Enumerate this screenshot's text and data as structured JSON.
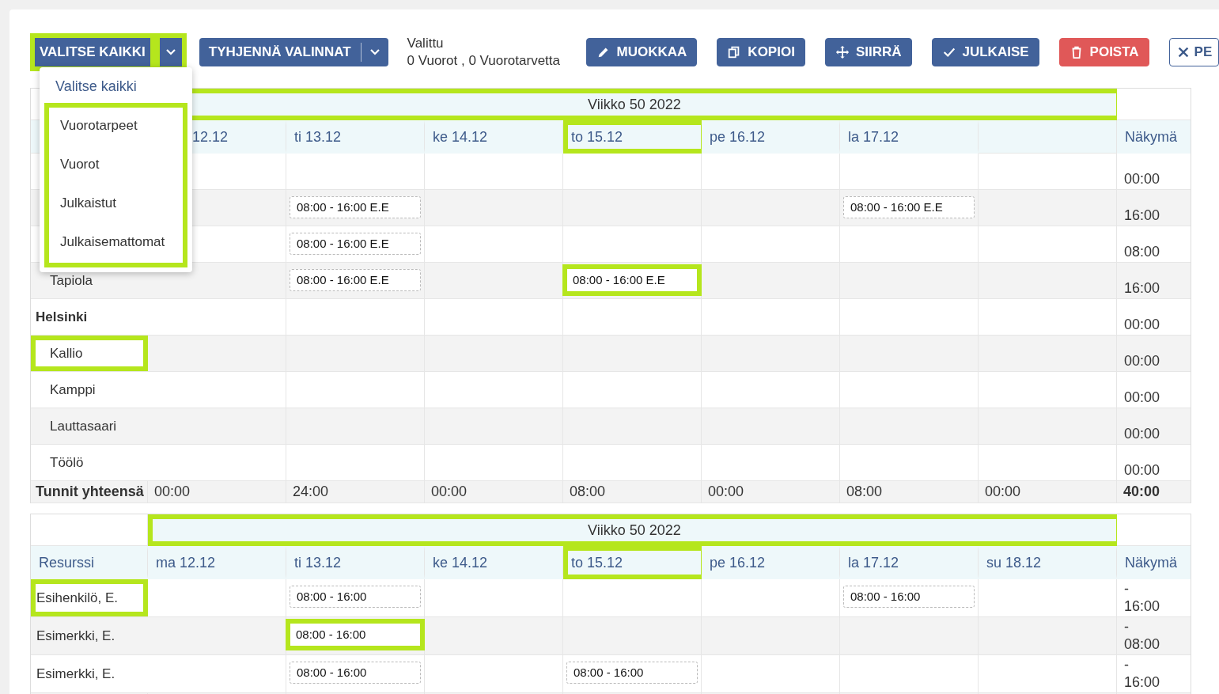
{
  "toolbar": {
    "select_all": {
      "label": "VALITSE KAIKKI",
      "highlighted": true,
      "toggle_highlighted": true
    },
    "clear": {
      "label": "TYHJENNÄ VALINNAT"
    },
    "selection_info": {
      "title": "Valittu",
      "summary": "0 Vuorot , 0 Vuorotarvetta"
    },
    "actions": [
      {
        "label": "MUOKKAA",
        "kind": "edit"
      },
      {
        "label": "KOPIOI",
        "kind": "copy"
      },
      {
        "label": "SIIRRÄ",
        "kind": "move"
      },
      {
        "label": "JULKAISE",
        "kind": "publish"
      },
      {
        "label": "POISTA",
        "kind": "delete"
      },
      {
        "label": "PE",
        "kind": "close"
      }
    ]
  },
  "select_menu": {
    "title": "Valitse kaikki",
    "options_highlighted": true,
    "options": [
      "Vuorotarpeet",
      "Vuorot",
      "Julkaistut",
      "Julkaisemattomat"
    ]
  },
  "tables": [
    {
      "week": {
        "label": "Viikko 50 2022",
        "highlighted": true
      },
      "days": [
        {
          "label": "12.12",
          "highlighted": false
        },
        {
          "label": "ti 13.12",
          "highlighted": false
        },
        {
          "label": "ke 14.12",
          "highlighted": false
        },
        {
          "label": "to 15.12",
          "highlighted": true
        },
        {
          "label": "pe 16.12",
          "highlighted": false
        },
        {
          "label": "la 17.12",
          "highlighted": false
        }
      ],
      "summary_header": "Näkymä",
      "rows": [
        {
          "kind": "hidden",
          "cells": [
            {},
            {},
            {},
            {},
            {},
            {},
            {}
          ],
          "summary": "00:00"
        },
        {
          "kind": "hidden",
          "cells": [
            {},
            {
              "shift": "08:00 - 16:00 E.E",
              "highlighted": false
            },
            {},
            {},
            {},
            {
              "shift": "08:00 - 16:00 E.E",
              "highlighted": false
            },
            {}
          ],
          "summary": "16:00"
        },
        {
          "kind": "hidden",
          "cells": [
            {},
            {
              "shift": "08:00 - 16:00 E.E",
              "highlighted": false
            },
            {},
            {},
            {},
            {},
            {}
          ],
          "summary": "08:00"
        },
        {
          "kind": "item",
          "label": "Tapiola",
          "highlighted": false,
          "cells": [
            {},
            {
              "shift": "08:00 - 16:00 E.E",
              "highlighted": false
            },
            {},
            {
              "shift": "08:00 - 16:00 E.E",
              "highlighted": true
            },
            {},
            {},
            {}
          ],
          "summary": "16:00"
        },
        {
          "kind": "group",
          "label": "Helsinki",
          "highlighted": false,
          "cells": [
            {},
            {},
            {},
            {},
            {},
            {},
            {}
          ],
          "summary": "00:00"
        },
        {
          "kind": "item",
          "label": "Kallio",
          "highlighted": true,
          "cells": [
            {},
            {},
            {},
            {},
            {},
            {},
            {}
          ],
          "summary": "00:00"
        },
        {
          "kind": "item",
          "label": "Kamppi",
          "highlighted": false,
          "cells": [
            {},
            {},
            {},
            {},
            {},
            {},
            {}
          ],
          "summary": "00:00"
        },
        {
          "kind": "item",
          "label": "Lauttasaari",
          "highlighted": false,
          "cells": [
            {},
            {},
            {},
            {},
            {},
            {},
            {}
          ],
          "summary": "00:00"
        },
        {
          "kind": "item",
          "label": "Töölö",
          "highlighted": false,
          "cells": [
            {},
            {},
            {},
            {},
            {},
            {},
            {}
          ],
          "summary": "00:00"
        }
      ],
      "totals": {
        "label": "Tunnit yhteensä",
        "values": [
          "00:00",
          "24:00",
          "00:00",
          "08:00",
          "00:00",
          "08:00",
          "00:00"
        ],
        "summary": "40:00"
      }
    },
    {
      "week": {
        "label": "Viikko 50 2022",
        "highlighted": true
      },
      "resource_header": "Resurssi",
      "days": [
        {
          "label": "ma 12.12",
          "highlighted": false
        },
        {
          "label": "ti 13.12",
          "highlighted": false
        },
        {
          "label": "ke 14.12",
          "highlighted": false
        },
        {
          "label": "to 15.12",
          "highlighted": true
        },
        {
          "label": "pe 16.12",
          "highlighted": false
        },
        {
          "label": "la 17.12",
          "highlighted": false
        },
        {
          "label": "su 18.12",
          "highlighted": false
        }
      ],
      "summary_header": "Näkymä",
      "rows": [
        {
          "kind": "person",
          "label": "Esihenkilö, E.",
          "highlighted": true,
          "cells": [
            {},
            {
              "shift": "08:00 - 16:00",
              "highlighted": false
            },
            {},
            {},
            {},
            {
              "shift": "08:00 - 16:00",
              "highlighted": false
            },
            {}
          ],
          "dash": "-",
          "summary": "16:00"
        },
        {
          "kind": "person",
          "label": "Esimerkki, E.",
          "highlighted": false,
          "cells": [
            {},
            {
              "shift": "08:00 - 16:00",
              "highlighted": true
            },
            {},
            {},
            {},
            {},
            {}
          ],
          "dash": "-",
          "summary": "08:00"
        },
        {
          "kind": "person",
          "label": "Esimerkki, E.",
          "highlighted": false,
          "cells": [
            {},
            {
              "shift": "08:00 - 16:00",
              "highlighted": false
            },
            {},
            {
              "shift": "08:00 - 16:00",
              "highlighted": false
            },
            {},
            {},
            {}
          ],
          "dash": "-",
          "summary": "16:00"
        },
        {
          "kind": "hidden",
          "cells": [
            {},
            {},
            {},
            {},
            {},
            {},
            {}
          ]
        }
      ]
    }
  ]
}
